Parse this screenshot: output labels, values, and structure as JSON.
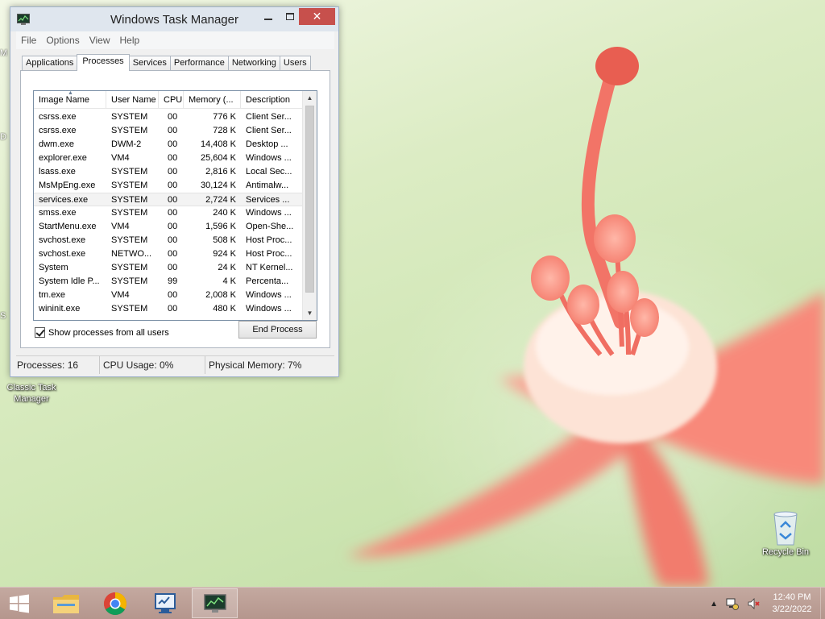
{
  "window": {
    "title": "Windows Task Manager",
    "minimize_glyph": "▭",
    "maximize_glyph": "□",
    "close_glyph": "✕"
  },
  "menu": [
    "File",
    "Options",
    "View",
    "Help"
  ],
  "tabs": [
    "Applications",
    "Processes",
    "Services",
    "Performance",
    "Networking",
    "Users"
  ],
  "active_tab": "Processes",
  "columns": [
    "Image Name",
    "User Name",
    "CPU",
    "Memory (...",
    "Description"
  ],
  "processes": [
    {
      "image": "csrss.exe",
      "user": "SYSTEM",
      "cpu": "00",
      "mem": "776 K",
      "desc": "Client Ser..."
    },
    {
      "image": "csrss.exe",
      "user": "SYSTEM",
      "cpu": "00",
      "mem": "728 K",
      "desc": "Client Ser..."
    },
    {
      "image": "dwm.exe",
      "user": "DWM-2",
      "cpu": "00",
      "mem": "14,408 K",
      "desc": "Desktop ..."
    },
    {
      "image": "explorer.exe",
      "user": "VM4",
      "cpu": "00",
      "mem": "25,604 K",
      "desc": "Windows ..."
    },
    {
      "image": "lsass.exe",
      "user": "SYSTEM",
      "cpu": "00",
      "mem": "2,816 K",
      "desc": "Local Sec..."
    },
    {
      "image": "MsMpEng.exe",
      "user": "SYSTEM",
      "cpu": "00",
      "mem": "30,124 K",
      "desc": "Antimalw..."
    },
    {
      "image": "services.exe",
      "user": "SYSTEM",
      "cpu": "00",
      "mem": "2,724 K",
      "desc": "Services ..."
    },
    {
      "image": "smss.exe",
      "user": "SYSTEM",
      "cpu": "00",
      "mem": "240 K",
      "desc": "Windows ..."
    },
    {
      "image": "StartMenu.exe",
      "user": "VM4",
      "cpu": "00",
      "mem": "1,596 K",
      "desc": "Open-She..."
    },
    {
      "image": "svchost.exe",
      "user": "SYSTEM",
      "cpu": "00",
      "mem": "508 K",
      "desc": "Host Proc..."
    },
    {
      "image": "svchost.exe",
      "user": "NETWO...",
      "cpu": "00",
      "mem": "924 K",
      "desc": "Host Proc..."
    },
    {
      "image": "System",
      "user": "SYSTEM",
      "cpu": "00",
      "mem": "24 K",
      "desc": "NT Kernel..."
    },
    {
      "image": "System Idle P...",
      "user": "SYSTEM",
      "cpu": "99",
      "mem": "4 K",
      "desc": "Percenta..."
    },
    {
      "image": "tm.exe",
      "user": "VM4",
      "cpu": "00",
      "mem": "2,008 K",
      "desc": "Windows ..."
    },
    {
      "image": "wininit.exe",
      "user": "SYSTEM",
      "cpu": "00",
      "mem": "480 K",
      "desc": "Windows ..."
    }
  ],
  "selected_row": 6,
  "show_all_users": {
    "label": "Show processes from all users",
    "checked": true
  },
  "end_process_label": "End Process",
  "status": {
    "processes": "Processes: 16",
    "cpu": "CPU Usage: 0%",
    "memory": "Physical Memory: 7%"
  },
  "desktop": {
    "classic_tm_label": "Classic Task Manager",
    "recycle_bin_label": "Recycle Bin",
    "edge_letters": [
      "M",
      "D",
      "S"
    ]
  },
  "taskbar": {
    "apps": [
      {
        "name": "file-explorer",
        "icon": "folder-icon"
      },
      {
        "name": "chrome",
        "icon": "chrome-icon"
      },
      {
        "name": "monitor-app",
        "icon": "monitor-icon"
      },
      {
        "name": "task-manager",
        "icon": "task-manager-icon"
      }
    ],
    "time": "12:40 PM",
    "date": "3/22/2022",
    "tray_arrow": "▲"
  },
  "colors": {
    "close_button": "#c7504c",
    "title_bar": "#dfe6ee",
    "taskbar": "#b5968d"
  }
}
